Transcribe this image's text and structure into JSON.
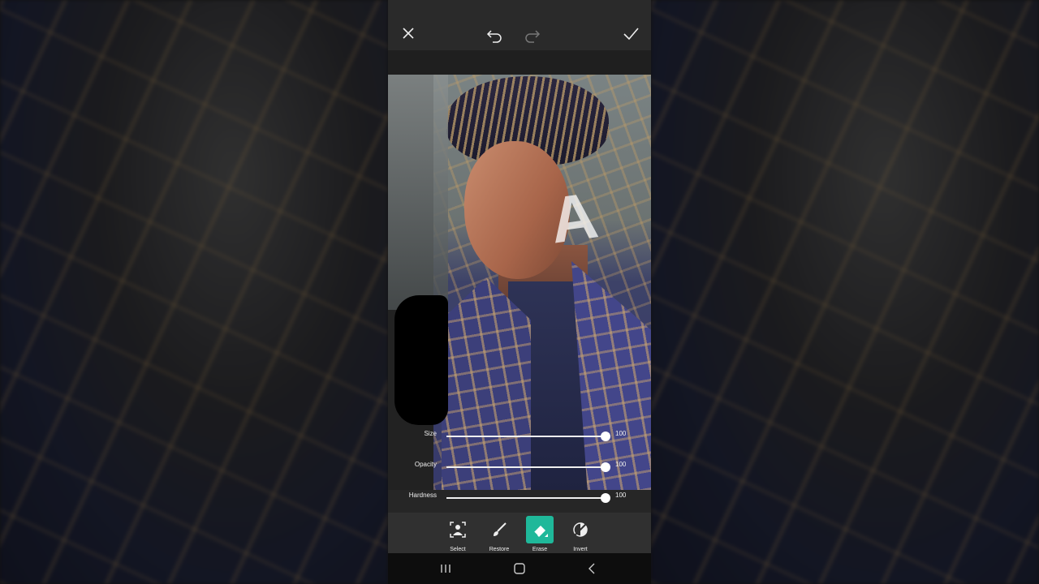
{
  "app": {
    "topbar": {
      "close_icon": "close-icon",
      "undo_icon": "undo-icon",
      "redo_icon": "redo-icon",
      "apply_icon": "check-icon"
    },
    "watermark_text": "A",
    "sliders": [
      {
        "label": "Size",
        "value": "100",
        "level": 1.0
      },
      {
        "label": "Opacity",
        "value": "100",
        "level": 1.0
      },
      {
        "label": "Hardness",
        "value": "100",
        "level": 1.0
      }
    ],
    "tools": [
      {
        "label": "Select",
        "icon": "select-person-icon",
        "active": false
      },
      {
        "label": "Restore",
        "icon": "brush-icon",
        "active": false
      },
      {
        "label": "Erase",
        "icon": "eraser-icon",
        "active": true
      },
      {
        "label": "Invert",
        "icon": "invert-icon",
        "active": false
      }
    ],
    "navbar": {
      "recents_icon": "recents-icon",
      "home_icon": "home-icon",
      "back_icon": "back-icon"
    },
    "colors": {
      "accent": "#1fb89a",
      "toolbar_bg": "#303030",
      "topbar_bg": "#2a2a2a"
    }
  }
}
